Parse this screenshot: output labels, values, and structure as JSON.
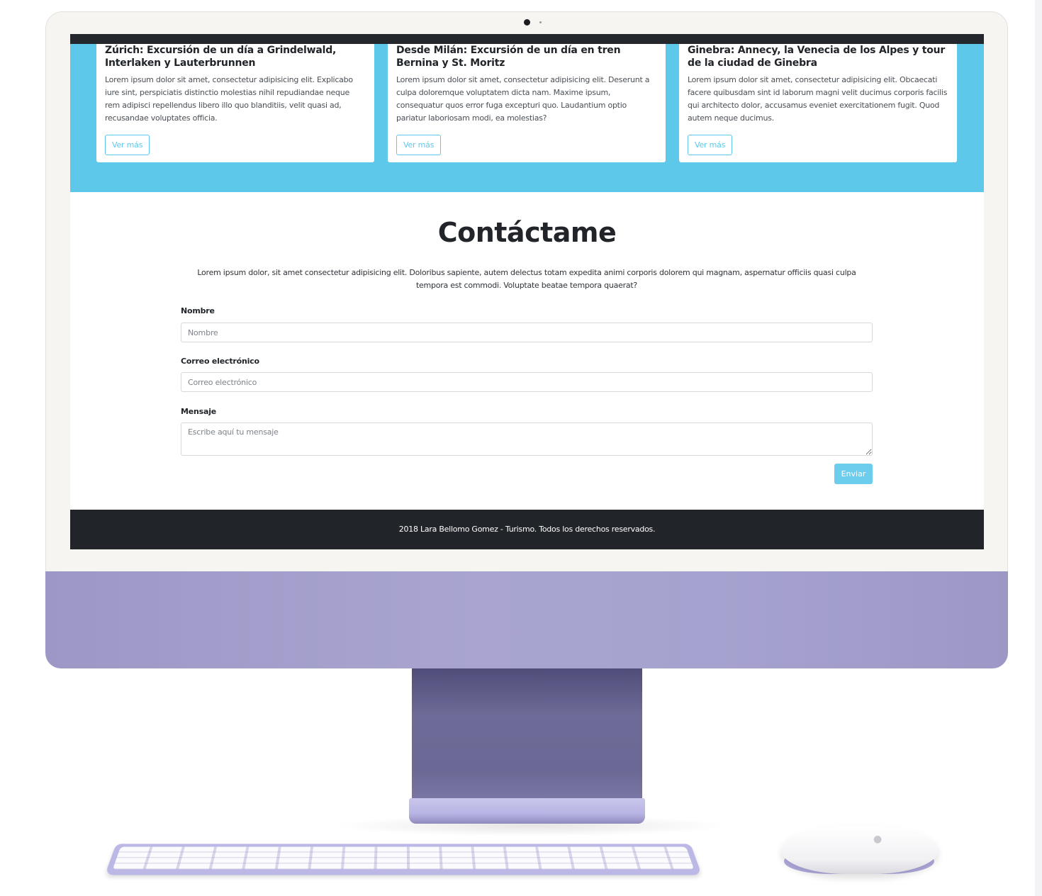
{
  "tours": [
    {
      "title": "Zúrich: Excursión de un día a Grindelwald, Interlaken y Lauterbrunnen",
      "text": "Lorem ipsum dolor sit amet, consectetur adipisicing elit. Explicabo iure sint, perspiciatis distinctio molestias nihil repudiandae neque rem adipisci repellendus libero illo quo blanditiis, velit quasi ad, recusandae voluptates officia.",
      "button": "Ver más"
    },
    {
      "title": "Desde Milán: Excursión de un día en tren Bernina y St. Moritz",
      "text": "Lorem ipsum dolor sit amet, consectetur adipisicing elit. Deserunt a culpa doloremque voluptatem dicta nam. Maxime ipsum, consequatur quos error fuga excepturi quo. Laudantium optio pariatur laboriosam modi, ea molestias?",
      "button": "Ver más"
    },
    {
      "title": "Ginebra: Annecy, la Venecia de los Alpes y tour de la ciudad de Ginebra",
      "text": "Lorem ipsum dolor sit amet, consectetur adipisicing elit. Obcaecati facere quibusdam sint id laborum magni velit ducimus corporis facilis qui architecto dolor, accusamus eveniet exercitationem fugit. Quod autem neque ducimus.",
      "button": "Ver más"
    }
  ],
  "contact": {
    "title": "Contáctame",
    "description": "Lorem ipsum dolor, sit amet consectetur adipisicing elit. Doloribus sapiente, autem delectus totam expedita animi corporis dolorem qui magnam, aspernatur officiis quasi culpa tempora est commodi. Voluptate beatae tempora quaerat?",
    "name_label": "Nombre",
    "name_placeholder": "Nombre",
    "email_label": "Correo electrónico",
    "email_placeholder": "Correo electrónico",
    "message_label": "Mensaje",
    "message_placeholder": "Escribe aquí tu mensaje",
    "submit": "Enviar"
  },
  "footer": {
    "text": "2018 Lara Bellomo Gomez - Turismo. Todos los derechos reservados."
  },
  "colors": {
    "accent": "#5ec8ea",
    "dark": "#212428",
    "device_purple": "#a6a2cf"
  },
  "icons": {
    "mouse_logo": "apple-logo-icon"
  }
}
